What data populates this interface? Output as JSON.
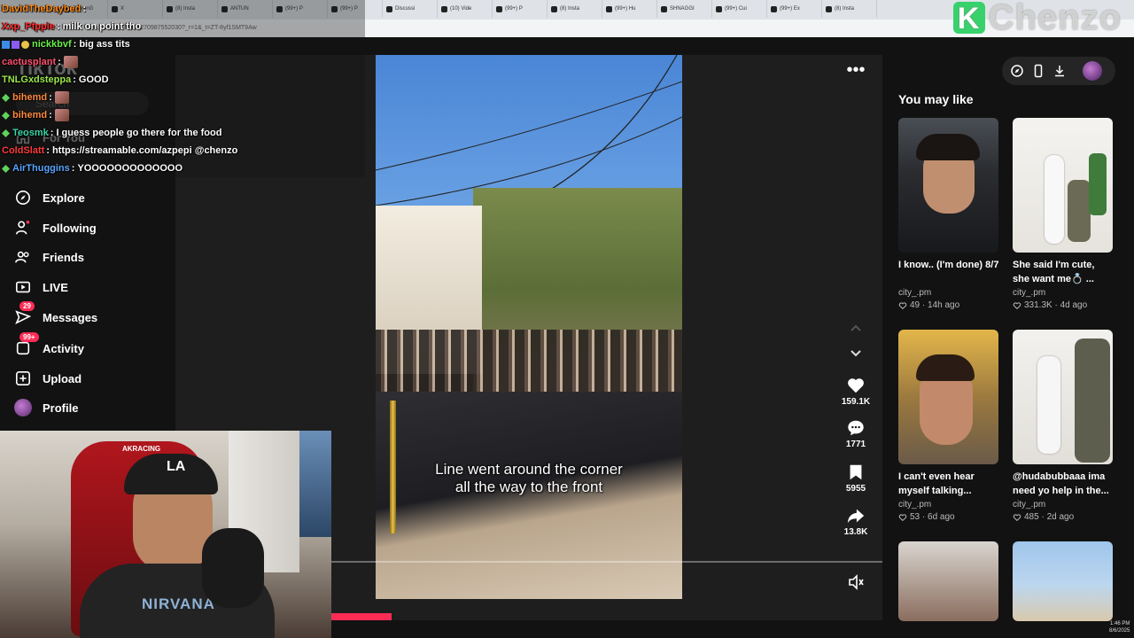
{
  "browser": {
    "tabs": [
      "StevenG",
      "X",
      "(8) Insta",
      "ANTUN",
      "(99+) P",
      "(99+) P",
      "Discussi",
      "(10) Vide",
      "(99+) P",
      "(8) Insta",
      "(99+) Hu",
      "SHNAGGI",
      "(99+) Cui",
      "(99+) Ex",
      "(8) Insta"
    ],
    "url": "...ideo/7533862270987552030?_r=1&_t=ZT-8yf1SMT9Aw"
  },
  "overlay_logo": {
    "mark": "K",
    "text": "Chenzo"
  },
  "chat": [
    {
      "user": "DavidTheDaybed",
      "color": "#ff8c1a",
      "msg": "",
      "badge": "none"
    },
    {
      "user": "Xxp_Pfpple",
      "color": "#ff3030",
      "msg": "milk on point tho",
      "badge": "none"
    },
    {
      "user": "nickkbvf",
      "color": "#6cf04a",
      "msg": "big ass tits",
      "badge": "multi"
    },
    {
      "user": "cactusplant",
      "color": "#ff4f6b",
      "msg": "",
      "badge": "none",
      "emote": true
    },
    {
      "user": "TNLGxdsteppa",
      "color": "#9be84c",
      "msg": "GOOD",
      "badge": "none"
    },
    {
      "user": "bihemd",
      "color": "#ff8a3d",
      "msg": "",
      "badge": "diamond",
      "emote": true
    },
    {
      "user": "bihemd",
      "color": "#ff8a3d",
      "msg": "",
      "badge": "diamond",
      "emote": true
    },
    {
      "user": "Teosmk",
      "color": "#3ad4a6",
      "msg": "I guess people go there for the food",
      "badge": "diamond"
    },
    {
      "user": "ColdSlatt",
      "color": "#ff3b3b",
      "msg": "https://streamable.com/azpepi @chenzo",
      "badge": "none"
    },
    {
      "user": "AirThuggins",
      "color": "#5aa5ff",
      "msg": "YOOOOOOOOOOOOO",
      "badge": "diamond"
    }
  ],
  "leftnav": {
    "logo": "TikTok",
    "search_placeholder": "Search",
    "items": [
      {
        "label": "For You",
        "icon": "home-icon"
      },
      {
        "label": "Explore",
        "icon": "compass-icon"
      },
      {
        "label": "Following",
        "icon": "following-icon"
      },
      {
        "label": "Friends",
        "icon": "friends-icon"
      },
      {
        "label": "LIVE",
        "icon": "live-icon"
      },
      {
        "label": "Messages",
        "icon": "messages-icon",
        "badge": "29"
      },
      {
        "label": "Activity",
        "icon": "activity-icon",
        "badge": "99+"
      },
      {
        "label": "Upload",
        "icon": "upload-icon"
      },
      {
        "label": "Profile",
        "icon": "avatar"
      }
    ]
  },
  "webcam": {
    "chair_text": "AKRACING",
    "cap_logo": "LA",
    "shirt_text": "NIRVANA"
  },
  "video": {
    "caption_line1": "Line went around the corner",
    "caption_line2": "all the way to the front",
    "progress": 0.11,
    "likes": "159.1K",
    "comments": "1771",
    "saves": "5955",
    "shares": "13.8K"
  },
  "right": {
    "heading": "You may like",
    "cards": [
      {
        "title": "I know.. (I'm done) 8/7",
        "author": "city_.pm",
        "likes": "49",
        "age": "14h ago"
      },
      {
        "title": "She said I'm cute, she want me💍 ...",
        "author": "city_.pm",
        "likes": "331.3K",
        "age": "4d ago"
      },
      {
        "title": "I can't even hear myself talking...",
        "author": "city_.pm",
        "likes": "53",
        "age": "6d ago"
      },
      {
        "title": "@hudabubbaaa ima need yo help in the...",
        "author": "city_.pm",
        "likes": "485",
        "age": "2d ago"
      }
    ]
  },
  "clock": {
    "time": "1:46 PM",
    "date": "8/6/2025"
  },
  "colors": {
    "accent": "#fe2c55",
    "background": "#121212"
  }
}
